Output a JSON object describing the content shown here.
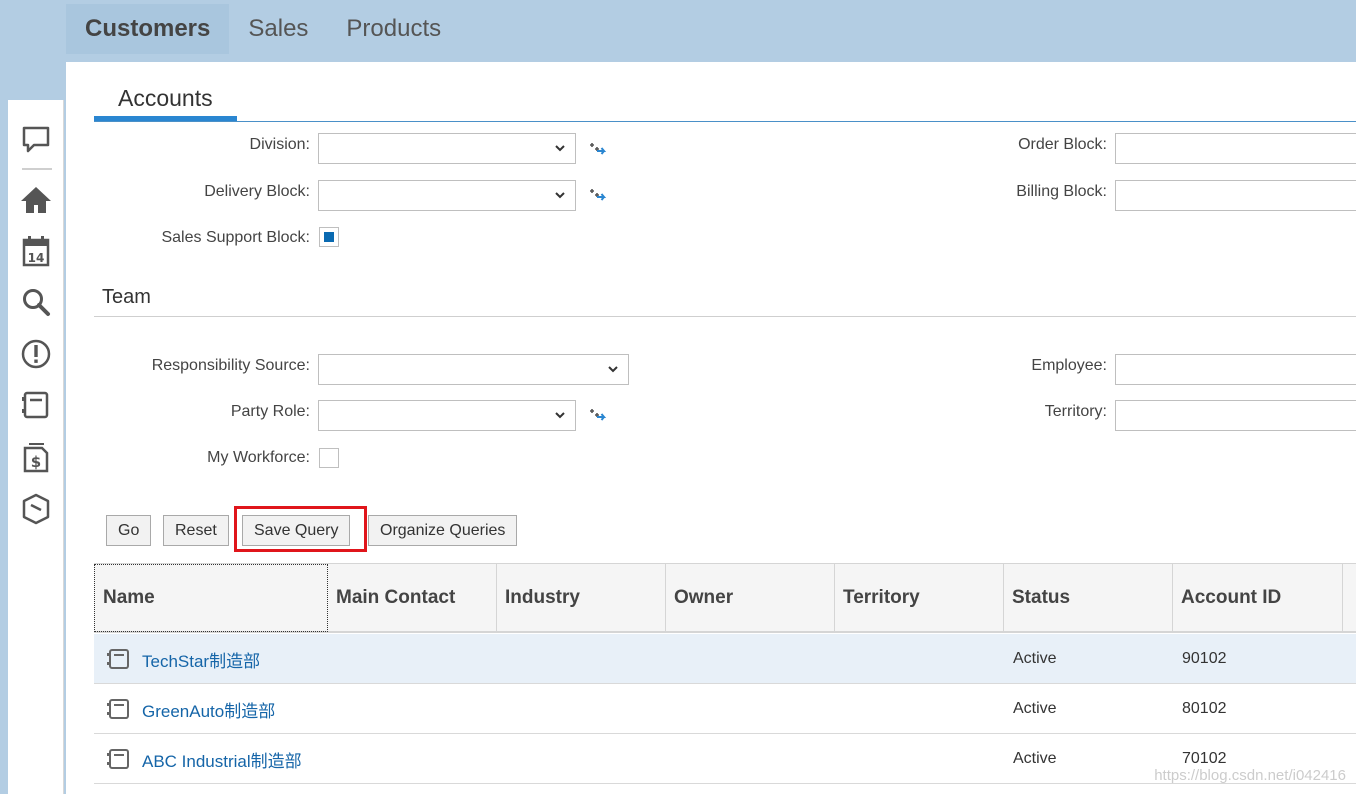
{
  "top_nav": {
    "tabs": [
      {
        "label": "Customers"
      },
      {
        "label": "Sales"
      },
      {
        "label": "Products"
      }
    ]
  },
  "rail": {
    "icons": [
      "feed-icon",
      "home-icon",
      "calendar-icon",
      "search-icon",
      "alert-icon",
      "worklist-icon",
      "sales-icon",
      "product-icon"
    ],
    "calendar_day": "14",
    "sales_symbol": "$"
  },
  "subtab": {
    "label": "Accounts"
  },
  "form": {
    "division_label": "Division:",
    "order_block_label": "Order Block:",
    "delivery_block_label": "Delivery Block:",
    "billing_block_label": "Billing Block:",
    "sales_support_block_label": "Sales Support Block:",
    "sales_support_block_checked": true,
    "team_title": "Team",
    "responsibility_source_label": "Responsibility Source:",
    "employee_label": "Employee:",
    "party_role_label": "Party Role:",
    "territory_label": "Territory:",
    "my_workforce_label": "My Workforce:",
    "my_workforce_checked": false
  },
  "buttons": {
    "go": "Go",
    "reset": "Reset",
    "save_query": "Save Query",
    "organize_queries": "Organize Queries"
  },
  "table": {
    "columns": [
      "Name",
      "Main Contact",
      "Industry",
      "Owner",
      "Territory",
      "Status",
      "Account ID"
    ],
    "rows": [
      {
        "name": "TechStar制造部",
        "main_contact": "",
        "industry": "",
        "owner": "",
        "territory": "",
        "status": "Active",
        "account_id": "90102"
      },
      {
        "name": "GreenAuto制造部",
        "main_contact": "",
        "industry": "",
        "owner": "",
        "territory": "",
        "status": "Active",
        "account_id": "80102"
      },
      {
        "name": "ABC Industrial制造部",
        "main_contact": "",
        "industry": "",
        "owner": "",
        "territory": "",
        "status": "Active",
        "account_id": "70102"
      }
    ]
  },
  "watermark": "https://blog.csdn.net/i042416",
  "colors": {
    "link": "#1565a8",
    "accent": "#2a86d1",
    "highlight": "#e0151b",
    "checkbox_fill": "#0a6ab1"
  }
}
